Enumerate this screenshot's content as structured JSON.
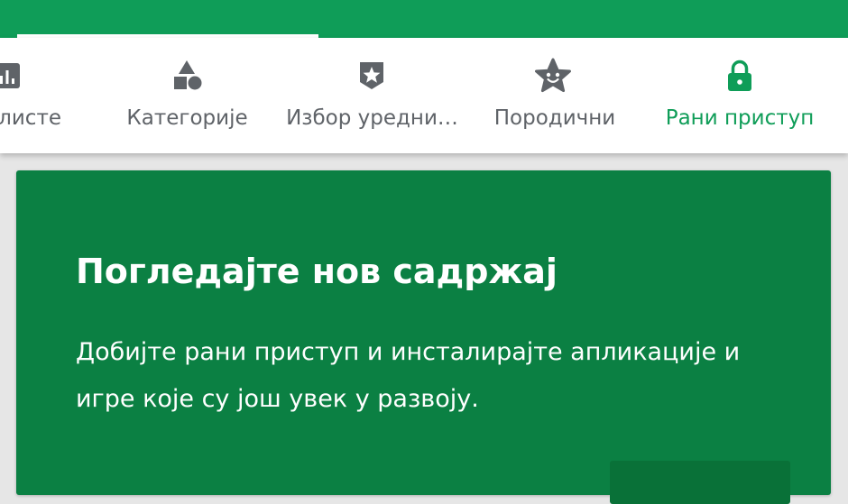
{
  "tabs": [
    {
      "id": "charts",
      "label": "листе",
      "icon": "bar-chart-icon",
      "active": false
    },
    {
      "id": "categories",
      "label": "Категорије",
      "icon": "shapes-icon",
      "active": false
    },
    {
      "id": "editors",
      "label": "Избор уредни…",
      "icon": "star-badge-icon",
      "active": false
    },
    {
      "id": "family",
      "label": "Породични",
      "icon": "smiling-star-icon",
      "active": false
    },
    {
      "id": "early-access",
      "label": "Рани приступ",
      "icon": "lock-icon",
      "active": true
    }
  ],
  "promo": {
    "title": "Погледајте нов садржај",
    "description": "Добијте рани приступ и инсталирајте апликације и игре које су још увек у развоју."
  },
  "colors": {
    "brand_green": "#0f9d58",
    "card_green": "#0b8043",
    "inactive_grey": "#5f6368"
  }
}
